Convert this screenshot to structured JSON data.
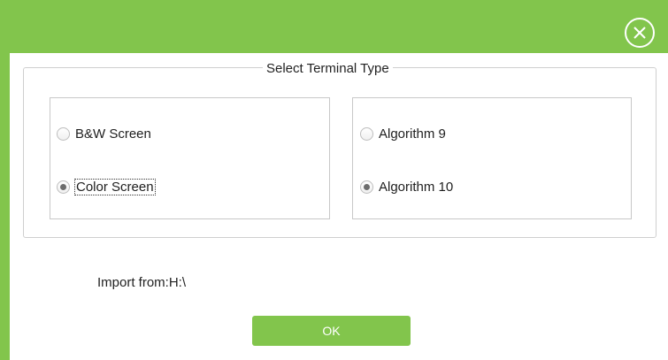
{
  "dialog": {
    "group_title": "Select Terminal Type",
    "screen_options": [
      {
        "label": "B&W Screen",
        "checked": false
      },
      {
        "label": "Color Screen",
        "checked": true
      }
    ],
    "algorithm_options": [
      {
        "label": "Algorithm 9",
        "checked": false
      },
      {
        "label": "Algorithm 10",
        "checked": true
      }
    ],
    "import_text": "Import from:H:\\",
    "ok_label": "OK",
    "close_icon": "close-circle-icon",
    "colors": {
      "accent": "#82c54c",
      "border": "#cfcfcf"
    }
  }
}
